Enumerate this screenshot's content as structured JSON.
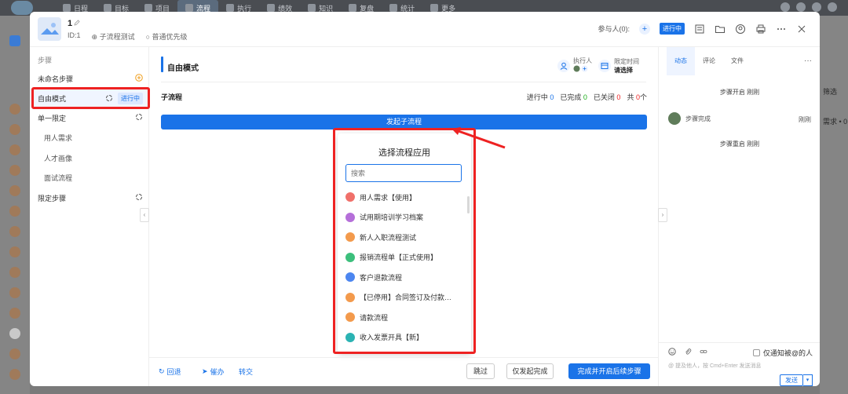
{
  "appbar": {
    "nav": [
      "日程",
      "目标",
      "项目",
      "流程",
      "执行",
      "绩效",
      "知识",
      "复盘",
      "统计",
      "更多"
    ],
    "active_index": 3
  },
  "background": {
    "filter_label": "筛选",
    "demand_label": "需求 • 0"
  },
  "modal": {
    "title": "1",
    "id_label": "ID:1",
    "flow_name": "子流程测试",
    "priority": "普通优先级",
    "participants_label": "参与人(0):",
    "status": "进行中"
  },
  "steps": {
    "header": "步骤",
    "items": [
      {
        "label": "未命名步骤",
        "sub": false
      },
      {
        "label": "自由模式",
        "sub": false,
        "status": "进行中"
      },
      {
        "label": "单一限定",
        "sub": false
      },
      {
        "label": "用人需求",
        "sub": true
      },
      {
        "label": "人才画像",
        "sub": true
      },
      {
        "label": "面试流程",
        "sub": true
      },
      {
        "label": "限定步骤",
        "sub": false
      }
    ]
  },
  "center": {
    "title": "自由模式",
    "executor_label": "执行人",
    "deadline_label": "限定时间",
    "deadline_value": "请选择",
    "subflow_label": "子流程",
    "stats": {
      "running_label": "进行中",
      "running": "0",
      "done_label": "已完成",
      "done": "0",
      "closed_label": "已关闭",
      "closed": "0",
      "total_label": "共",
      "total": "0",
      "unit": "个"
    },
    "start_button": "发起子流程"
  },
  "dropdown": {
    "title": "选择流程应用",
    "search_placeholder": "搜索",
    "items": [
      {
        "label": "用人需求【使用】",
        "color": "#f0706a"
      },
      {
        "label": "试用期培训学习档案",
        "color": "#b56fd9"
      },
      {
        "label": "新人入职流程测试",
        "color": "#f39a4c"
      },
      {
        "label": "报销流程单【正式使用】",
        "color": "#3cbf7c"
      },
      {
        "label": "客户退款流程",
        "color": "#4c86f0"
      },
      {
        "label": "【已停用】合同签订及付款…",
        "color": "#f39a4c"
      },
      {
        "label": "请款流程",
        "color": "#f39a4c"
      },
      {
        "label": "收入发票开具【新】",
        "color": "#2bb3b3"
      }
    ]
  },
  "bottom": {
    "back": "回退",
    "urge": "催办",
    "transfer": "转交",
    "skip": "跳过",
    "only_done": "仅发起完成",
    "complete_next": "完成并开启后续步骤"
  },
  "right": {
    "tabs": [
      "动态",
      "评论",
      "文件"
    ],
    "activities": [
      {
        "text": "步骤开启 刚刚"
      },
      {
        "text": "步骤完成",
        "time": "刚刚"
      },
      {
        "text": "步骤重启 刚刚"
      }
    ],
    "notify_label": "仅通知被@的人",
    "hint": "@ 提及他人，按 Cmd+Enter 发送消息",
    "send": "发送"
  }
}
